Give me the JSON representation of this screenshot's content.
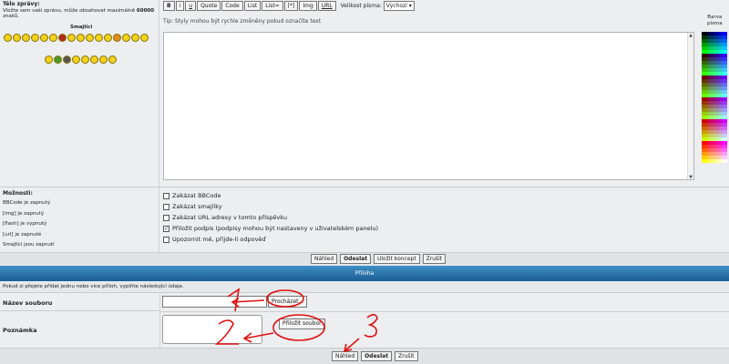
{
  "sidebar": {
    "title": "Tělo zprávy:",
    "description_pre": "Vložte sem vaši zprávu, může obsahovat maximálně ",
    "description_bold": "60000",
    "description_post": " znaků.",
    "smileys_label": "Smajlíci"
  },
  "toolbar": {
    "buttons": [
      "B",
      "i",
      "u",
      "Quote",
      "Code",
      "List",
      "List=",
      "[*]",
      "Img",
      "URL"
    ],
    "font_size_label": "Velikost písma:",
    "font_size_value": "Výchozí",
    "tip": "Tip: Styly mohou být rychle změněny pokud označíte text"
  },
  "color_panel": {
    "label_line1": "Barva",
    "label_line2": "písma"
  },
  "options": {
    "title": "Možnosti:",
    "status": [
      "BBCode je zapnutý",
      "[img] je zapnutý",
      "[flash] je vypnutý",
      "[url] je zapnuté",
      "Smajlíci jsou zapnutí"
    ],
    "checkboxes": [
      {
        "label": "Zakázat BBCode",
        "checked": false
      },
      {
        "label": "Zakázat smajlíky",
        "checked": false
      },
      {
        "label": "Zakázat URL adresy v tomto příspěvku",
        "checked": false
      },
      {
        "label": "Přiložit podpis (podpisy mohou být nastaveny v uživatelském panelu)",
        "checked": true
      },
      {
        "label": "Upozornit mě, přijde-li odpověď",
        "checked": false
      }
    ]
  },
  "actions_top": {
    "preview": "Náhled",
    "submit": "Odeslat",
    "save_draft": "Uložit koncept",
    "cancel": "Zrušit"
  },
  "attachments": {
    "header": "Příloha",
    "hint": "Pokud si přejete přidat jednu nebo více příloh, vyplňte následující údaje.",
    "filename_label": "Název souboru",
    "browse_button": "Procházet...",
    "note_label": "Poznámka",
    "attach_button": "Přiložit soubor"
  },
  "actions_bottom": {
    "preview": "Náhled",
    "submit": "Odeslat",
    "cancel": "Zrušit"
  },
  "annotations": [
    "1",
    "2",
    "3"
  ],
  "colors": {
    "accent_blue": "#1b5e93",
    "annotation_red": "#e01010",
    "panel_bg": "#eceef0"
  }
}
